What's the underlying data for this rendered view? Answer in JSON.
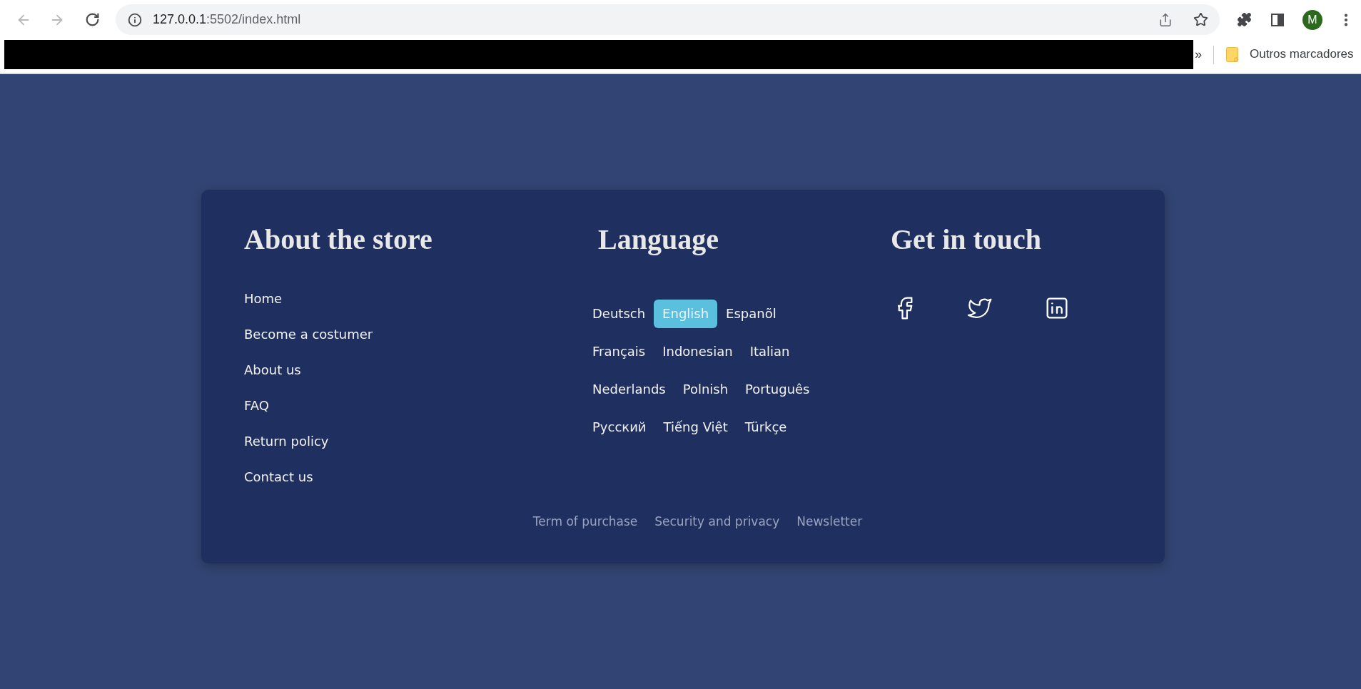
{
  "browser": {
    "back": {
      "disabled": true
    },
    "forward": {
      "disabled": true
    },
    "address_bar": {
      "host": "127.0.0.1",
      "path": ":5502/index.html"
    },
    "profile": {
      "initial": "M"
    },
    "bookmarks_bar": {
      "overflow": "»",
      "folder": "Outros marcadores"
    }
  },
  "footer": {
    "about": {
      "title": "About the store",
      "links": [
        "Home",
        "Become a costumer",
        "About us",
        "FAQ",
        "Return policy",
        "Contact us"
      ]
    },
    "language": {
      "title": "Language",
      "options": [
        {
          "label": "Deutsch",
          "selected": false
        },
        {
          "label": "English",
          "selected": true
        },
        {
          "label": "Espanõl",
          "selected": false
        },
        {
          "label": "Français",
          "selected": false
        },
        {
          "label": "Indonesian",
          "selected": false
        },
        {
          "label": "Italian",
          "selected": false
        },
        {
          "label": "Nederlands",
          "selected": false
        },
        {
          "label": "Polnish",
          "selected": false
        },
        {
          "label": "Português",
          "selected": false
        },
        {
          "label": "Русский",
          "selected": false
        },
        {
          "label": "Tiếng Việt",
          "selected": false
        },
        {
          "label": "Türkçe",
          "selected": false
        }
      ]
    },
    "contact": {
      "title": "Get in touch"
    },
    "bottom_links": [
      "Term of purchase",
      "Security and privacy",
      "Newsletter"
    ]
  }
}
